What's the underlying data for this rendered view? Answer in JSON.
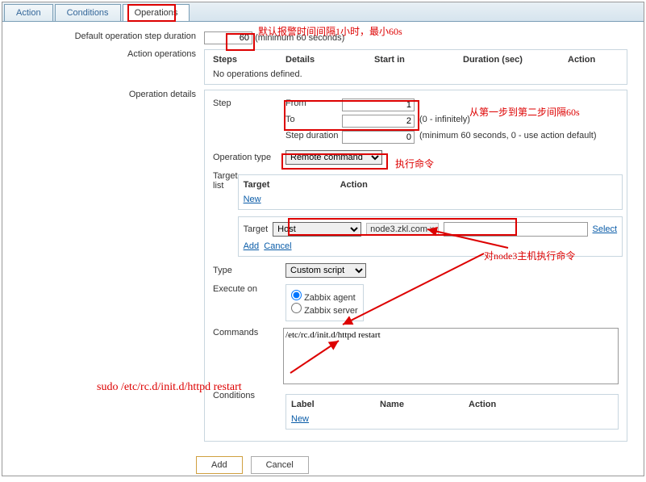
{
  "tabs": {
    "action": "Action",
    "conditions": "Conditions",
    "operations": "Operations"
  },
  "ann": {
    "top": "默认报警时间间隔1小时，最小60s",
    "right": "从第一步到第二步间隔60s",
    "exec": "执行命令",
    "node": "对node3主机执行命令",
    "sudo": "sudo /etc/rc.d/init.d/httpd restart"
  },
  "labels": {
    "defStep": "Default operation step duration",
    "defStepHint": "(minimum 60 seconds)",
    "actionOps": "Action operations",
    "opDetails": "Operation details",
    "steps": "Steps",
    "details": "Details",
    "startIn": "Start in",
    "durSec": "Duration (sec)",
    "action": "Action",
    "noOps": "No operations defined.",
    "step": "Step",
    "from": "From",
    "to": "To",
    "infinite": "(0 - infinitely)",
    "stepDur": "Step duration",
    "stepDurHint": "(minimum 60 seconds, 0 - use action default)",
    "opType": "Operation type",
    "remoteCmd": "Remote command",
    "targetList": "Target list",
    "target": "Target",
    "new": "New",
    "host": "Host",
    "hostName": "node3.zkl.com",
    "select": "Select",
    "addL": "Add",
    "cancelL": "Cancel",
    "type": "Type",
    "customScript": "Custom script",
    "execOn": "Execute on",
    "zAgent": "Zabbix agent",
    "zServer": "Zabbix server",
    "commands": "Commands",
    "cmdVal": "/etc/rc.d/init.d/httpd restart",
    "conditions": "Conditions",
    "label": "Label",
    "name": "Name"
  },
  "vals": {
    "defStep": "60",
    "from": "1",
    "to": "2",
    "stepDur": "0"
  },
  "btns": {
    "add": "Add",
    "cancel": "Cancel"
  }
}
